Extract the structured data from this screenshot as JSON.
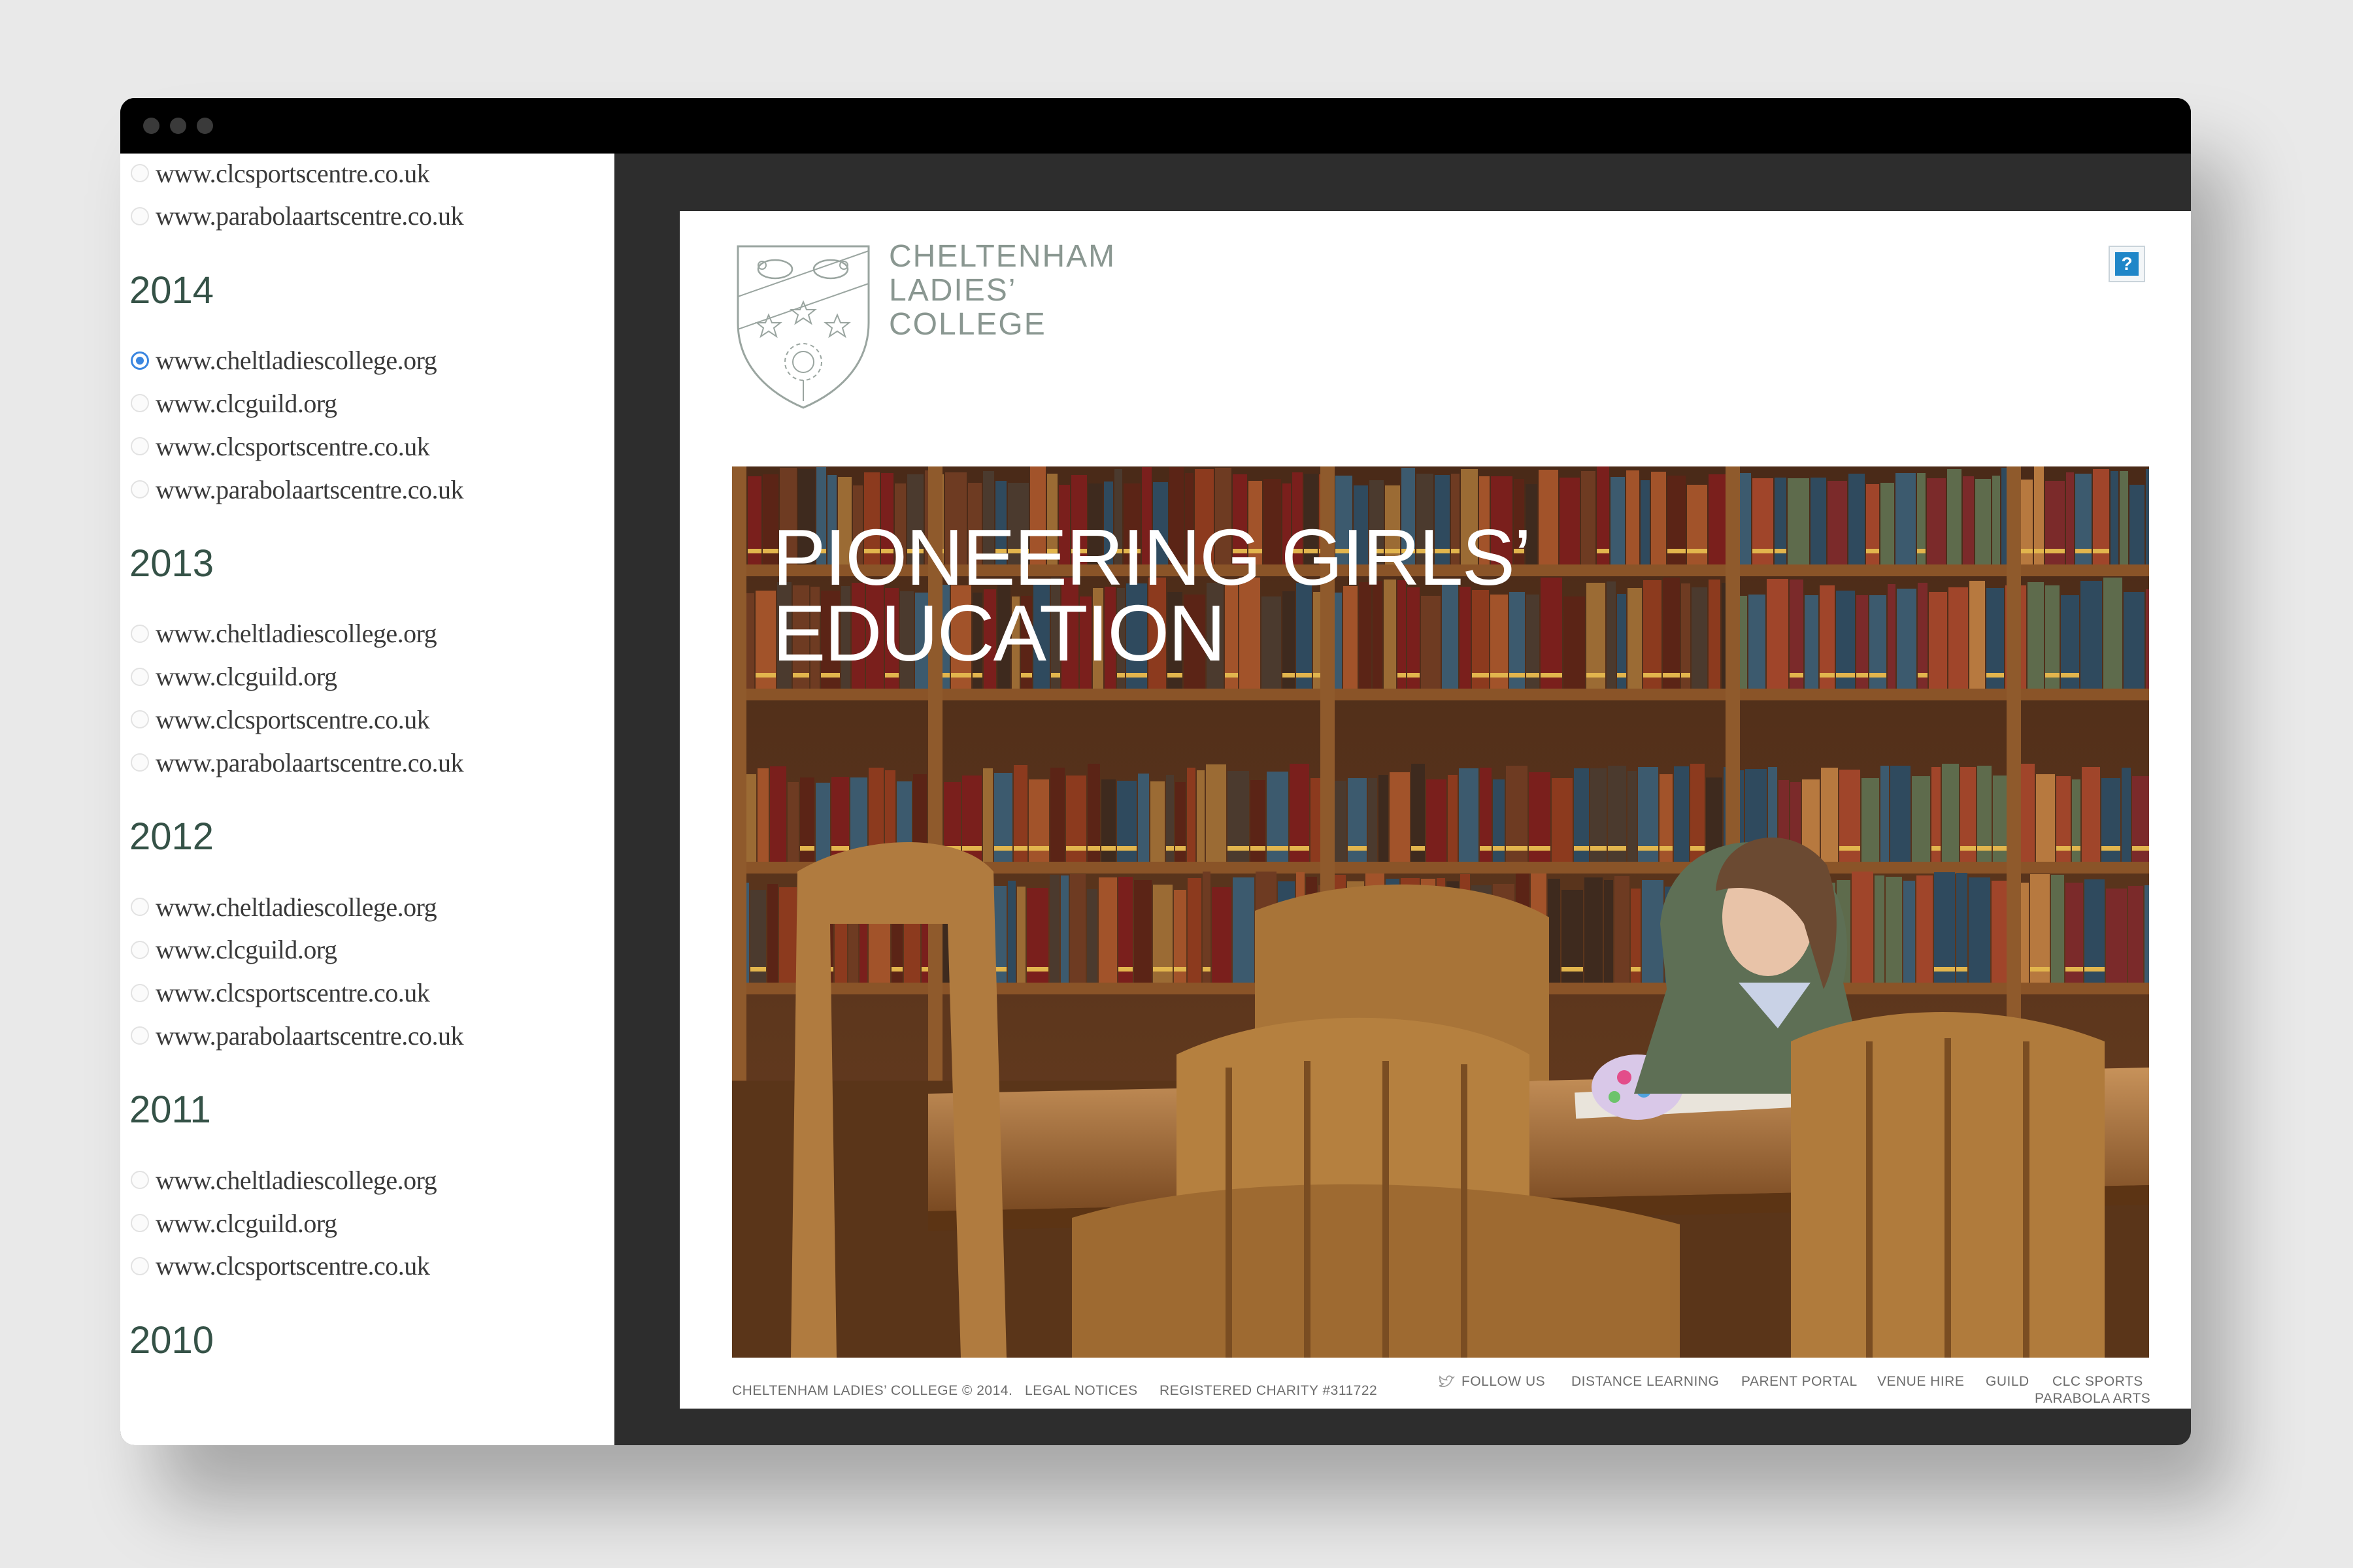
{
  "sidebar": {
    "groups": [
      {
        "year": "",
        "items": [
          {
            "url": "www.clcsportscentre.co.uk",
            "selected": false
          },
          {
            "url": "www.parabolaartscentre.co.uk",
            "selected": false
          }
        ]
      },
      {
        "year": "2014",
        "items": [
          {
            "url": "www.cheltladiescollege.org",
            "selected": true
          },
          {
            "url": "www.clcguild.org",
            "selected": false
          },
          {
            "url": "www.clcsportscentre.co.uk",
            "selected": false
          },
          {
            "url": "www.parabolaartscentre.co.uk",
            "selected": false
          }
        ]
      },
      {
        "year": "2013",
        "items": [
          {
            "url": "www.cheltladiescollege.org",
            "selected": false
          },
          {
            "url": "www.clcguild.org",
            "selected": false
          },
          {
            "url": "www.clcsportscentre.co.uk",
            "selected": false
          },
          {
            "url": "www.parabolaartscentre.co.uk",
            "selected": false
          }
        ]
      },
      {
        "year": "2012",
        "items": [
          {
            "url": "www.cheltladiescollege.org",
            "selected": false
          },
          {
            "url": "www.clcguild.org",
            "selected": false
          },
          {
            "url": "www.clcsportscentre.co.uk",
            "selected": false
          },
          {
            "url": "www.parabolaartscentre.co.uk",
            "selected": false
          }
        ]
      },
      {
        "year": "2011",
        "items": [
          {
            "url": "www.cheltladiescollege.org",
            "selected": false
          },
          {
            "url": "www.clcguild.org",
            "selected": false
          },
          {
            "url": "www.clcsportscentre.co.uk",
            "selected": false
          }
        ]
      },
      {
        "year": "2010",
        "items": []
      }
    ]
  },
  "site": {
    "brand_lines": [
      "CHELTENHAM",
      "LADIES’",
      "COLLEGE"
    ],
    "help_label": "?",
    "hero_title_lines": [
      "PIONEERING GIRLS’",
      "EDUCATION"
    ],
    "footer_left": [
      "CHELTENHAM LADIES’ COLLEGE © 2014.",
      "LEGAL NOTICES",
      "REGISTERED CHARITY #311722"
    ],
    "footer_right": {
      "follow": "FOLLOW US",
      "links": [
        "DISTANCE LEARNING",
        "PARENT PORTAL",
        "VENUE HIRE",
        "GUILD"
      ],
      "sports": "CLC SPORTS",
      "parabola": "PARABOLA ARTS"
    }
  },
  "colors": {
    "accent_radio": "#3a86e0",
    "year_heading": "#355247",
    "brand_text": "#8a9791",
    "help_button": "#1f86c8"
  },
  "icons": [
    "twitter-icon",
    "help-icon",
    "college-crest-icon"
  ]
}
